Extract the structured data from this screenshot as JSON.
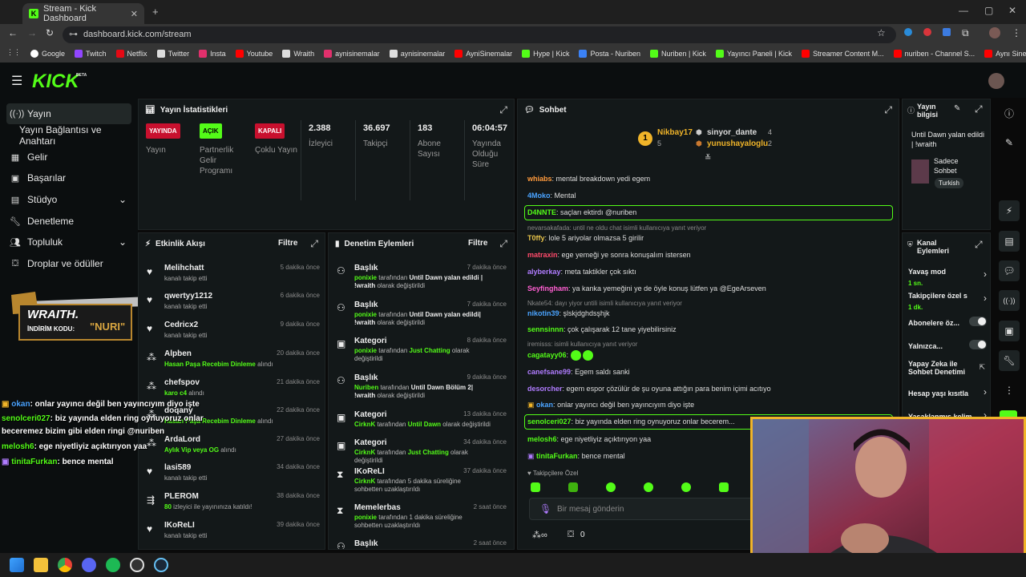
{
  "browser": {
    "tab_title": "Stream - Kick Dashboard",
    "url": "dashboard.kick.com/stream",
    "bookmarks": [
      "Google",
      "Twitch",
      "Netflix",
      "Twitter",
      "Insta",
      "Youtube",
      "Wraith",
      "aynisinemalar",
      "aynisinemalar",
      "AyniSinemalar",
      "Hype | Kick",
      "Posta - Nuriben",
      "Nuriben | Kick",
      "Yayıncı Paneli | Kick",
      "Streamer Content M...",
      "nuriben - Channel S...",
      "Aynı Sinemalar - Ça..."
    ]
  },
  "app": {
    "logo": "KICK",
    "logo_beta": "BETA"
  },
  "sidebar": {
    "items": [
      {
        "label": "Yayın",
        "icon": "broadcast-icon"
      },
      {
        "label": "Yayın Bağlantısı ve Anahtarı",
        "icon": ""
      },
      {
        "label": "Gelir",
        "icon": "revenue-icon"
      },
      {
        "label": "Başarılar",
        "icon": "achievements-icon"
      },
      {
        "label": "Stüdyo",
        "icon": "studio-icon"
      },
      {
        "label": "Denetleme",
        "icon": "wrench-icon"
      },
      {
        "label": "Topluluk",
        "icon": "community-icon"
      },
      {
        "label": "Droplar ve ödüller",
        "icon": "gift-icon"
      }
    ],
    "promo": {
      "brand": "WRAITH.",
      "code_label": "İNDİRİM KODU:",
      "code": "\"NURI\""
    }
  },
  "stats": {
    "title": "Yayın İstatistikleri",
    "items": [
      {
        "badge": "YAYINDA",
        "label": "Yayın"
      },
      {
        "badge": "AÇIK",
        "label": "Partnerlik Gelir Programı"
      },
      {
        "badge": "KAPALI",
        "label": "Çoklu Yayın"
      },
      {
        "value": "2.388",
        "label": "İzleyici"
      },
      {
        "value": "36.697",
        "label": "Takipçi"
      },
      {
        "value": "183",
        "label": "Abone Sayısı"
      },
      {
        "value": "06:04:57",
        "label": "Yayında Olduğu Süre"
      }
    ]
  },
  "activity": {
    "title": "Etkinlik Akışı",
    "filter": "Filtre",
    "items": [
      {
        "name": "Melihchatt",
        "sub": "kanalı takip etti",
        "time": "5 dakika önce"
      },
      {
        "name": "qwertyy1212",
        "sub": "kanalı takip etti",
        "time": "6 dakika önce"
      },
      {
        "name": "Cedricx2",
        "sub": "kanalı takip etti",
        "time": "9 dakika önce"
      },
      {
        "name": "Alpben",
        "sub_g": "Hasan Paşa Recebim Dinleme",
        "sub": " alındı",
        "time": "20 dakika önce"
      },
      {
        "name": "chefspov",
        "sub_g": "karo c4",
        "sub": " alındı",
        "time": "21 dakika önce"
      },
      {
        "name": "doqany",
        "sub_g": "Hasan Paşa Recebim Dinleme",
        "sub": " alındı",
        "time": "22 dakika önce"
      },
      {
        "name": "ArdaLord",
        "sub_g": "Aylık Vip veya OG",
        "sub": " alındı",
        "time": "27 dakika önce"
      },
      {
        "name": "lasi589",
        "sub": "kanalı takip etti",
        "time": "34 dakika önce"
      },
      {
        "name": "PLEROM",
        "sub_g": "80",
        "sub": " izleyici ile yayınınıza katıldı!",
        "time": "38 dakika önce"
      },
      {
        "name": "IKoReLI",
        "sub": "kanalı takip etti",
        "time": "39 dakika önce"
      }
    ]
  },
  "moderation": {
    "title": "Denetim Eylemleri",
    "filter": "Filtre",
    "items": [
      {
        "name": "Başlık",
        "user": "ponixie",
        "mid": " tarafından ",
        "target": "Until Dawn yalan edildi | !wraith",
        "end": " olarak değiştirildi",
        "time": "7 dakika önce"
      },
      {
        "name": "Başlık",
        "user": "ponixie",
        "mid": " tarafından ",
        "target": "Until Dawn yalan edildi| !wraith",
        "end": " olarak değiştirildi",
        "time": "7 dakika önce"
      },
      {
        "name": "Kategori",
        "user": "ponixie",
        "mid": " tarafından ",
        "target": "Just Chatting",
        "end": " olarak değiştirildi",
        "time": "8 dakika önce"
      },
      {
        "name": "Başlık",
        "user": "Nuriben",
        "mid": " tarafından ",
        "target": "Until Dawn Bölüm 2| !wraith",
        "end": " olarak değiştirildi",
        "time": "9 dakika önce"
      },
      {
        "name": "Kategori",
        "user": "CirknK",
        "mid": " tarafından ",
        "target": "Until Dawn",
        "end": " olarak değiştirildi",
        "time": "13 dakika önce"
      },
      {
        "name": "Kategori",
        "user": "CirknK",
        "mid": " tarafından ",
        "target": "Just Chatting",
        "end": " olarak değiştirildi",
        "time": "34 dakika önce"
      },
      {
        "name": "IKoReLI",
        "user": "CirknK",
        "mid": " tarafından 5 dakika süreliğine sohbetten uzaklaştırıldı",
        "target": "",
        "end": "",
        "time": "37 dakika önce"
      },
      {
        "name": "Memelerbas",
        "user": "ponixie",
        "mid": " tarafından 1 dakika süreliğine sohbetten uzaklaştırıldı",
        "target": "",
        "end": "",
        "time": "2 saat önce"
      },
      {
        "name": "Başlık",
        "user": "",
        "mid": "",
        "target": "",
        "end": "",
        "time": "2 saat önce"
      }
    ]
  },
  "chat": {
    "title": "Sohbet",
    "top": [
      {
        "name": "Nikbay17",
        "count": "5"
      },
      {
        "name": "sinyor_dante",
        "count": "4"
      },
      {
        "name": "yunushayaloglu",
        "count": "2"
      }
    ],
    "rank": "1",
    "messages": [
      {
        "user": "whiabs",
        "color": "#ff9a3c",
        "text": "mental breakdown yedi egem"
      },
      {
        "user": "4Moko",
        "color": "#4aa3ff",
        "text": "Mental"
      },
      {
        "user": "D4NNTE",
        "color": "#53fc18",
        "text": "saçları ektirdı @nuriben"
      },
      {
        "reply": "nevarsakafada: until ne oldu chat isimli kullanıcıya yanıt veriyor"
      },
      {
        "user": "T0ffy",
        "color": "#e6c34a",
        "text": "lole 5 ariyolar olmazsa 5 girilir"
      },
      {
        "user": "matraxin",
        "color": "#ff4a6b",
        "text": "ege yemeği ye sonra konuşalım istersen"
      },
      {
        "user": "alyberkay",
        "color": "#b07cff",
        "text": "meta taktikler çok sıktı"
      },
      {
        "user": "Seyfingham",
        "color": "#ff5fd2",
        "text": "ya kanka yemeğini ye de öyle konuş lütfen ya @EgeArseven"
      },
      {
        "reply": "Nkate54: dayı yiyor untili isimli kullanıcıya yanıt veriyor"
      },
      {
        "user": "nikotin39",
        "color": "#4aa3ff",
        "text": "şlskjdghdsşhjk"
      },
      {
        "user": "sennsinnn",
        "color": "#53fc18",
        "text": "çok çalışarak 12 tane yiyebilirsiniz"
      },
      {
        "reply": "iremisss: isimli kullanıcıya yanıt veriyor"
      },
      {
        "user": "cagatayy06",
        "color": "#53fc18",
        "text": ""
      },
      {
        "user": "canefsane99",
        "color": "#b07cff",
        "text": "Egem saldı sanki"
      },
      {
        "user": "desorcher",
        "color": "#b07cff",
        "text": "egem espor çözülür de şu oyuna attığın para benim içimi acıtıyo"
      },
      {
        "user": "okan",
        "color": "#4aa3ff",
        "text": "onlar yayıncı değil ben yayıncıyım diyo işte"
      },
      {
        "user": "senolceri027",
        "color": "#53fc18",
        "text": "biz yayında elden ring oynuyoruz onlar becerem..."
      },
      {
        "user": "melosh6",
        "color": "#53fc18",
        "text": "ege niyetliyiz açıktırıyon yaa"
      },
      {
        "user": "tinitaFurkan",
        "color": "#53fc18",
        "text": "bence mental"
      }
    ],
    "followers_only": "Takipçilere Özel",
    "input_placeholder": "Bir mesaj gönderin",
    "points": "0"
  },
  "stream_info": {
    "title": "Yayın bilgisi",
    "stream_title": "Until Dawn yalan edildi | !wraith",
    "category": "Sadece Sohbet",
    "language": "Turkish"
  },
  "channel_actions": {
    "title": "Kanal Eylemleri",
    "items": [
      {
        "label": "Yavaş mod",
        "sub": "1 sn."
      },
      {
        "label": "Takipçilere özel s",
        "sub": "1 dk."
      },
      {
        "label": "Abonelere öz..."
      },
      {
        "label": "Yalnızca..."
      },
      {
        "label": "Yapay Zeka ile Sohbet Denetimi"
      },
      {
        "label": "Hesap yaşı kısıtla"
      },
      {
        "label": "Yasaklanmış kelim"
      }
    ]
  },
  "overlay_chat": [
    {
      "user": "okan",
      "text": ": onlar yayıncı değil ben yayıncıyım diyo işte"
    },
    {
      "user": "senolceri027",
      "text": ": biz yayında elden ring oynuyoruz onlar"
    },
    {
      "user": "",
      "text": "beceremez bizim gibi elden ringi @nuriben"
    },
    {
      "user": "melosh6",
      "text": ": ege niyetliyiz açıktırıyon yaa"
    },
    {
      "user": "tinitaFurkan",
      "text": ": bence mental"
    }
  ]
}
